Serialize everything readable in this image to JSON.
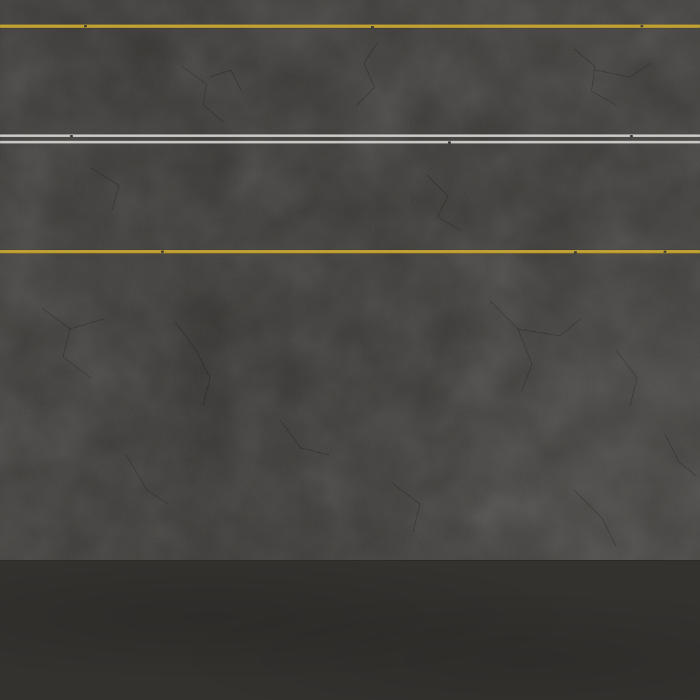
{
  "scene": {
    "subject": "road-surface",
    "colors": {
      "asphalt": "#3b3936",
      "shoulder": "#34322f",
      "yellow_line": "#c9a83a",
      "white_line": "#d4d2ce"
    },
    "lane_markings": [
      {
        "color": "yellow",
        "style": "single-solid"
      },
      {
        "color": "white",
        "style": "double-solid"
      },
      {
        "color": "yellow",
        "style": "single-solid"
      }
    ]
  }
}
